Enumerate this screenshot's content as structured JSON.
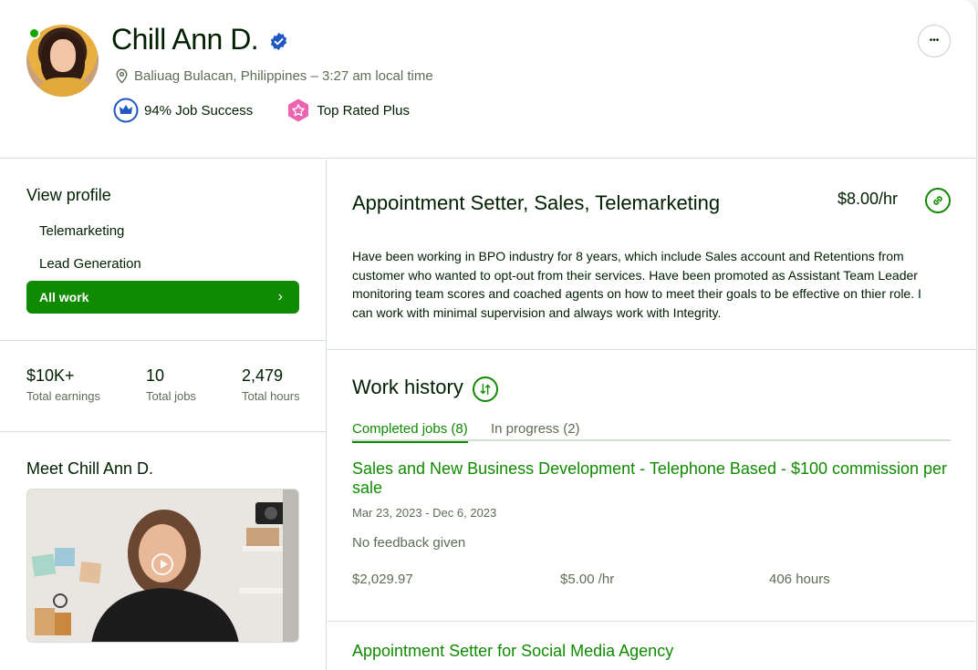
{
  "profile": {
    "name": "Chill Ann D.",
    "location": "Baliuag Bulacan, Philippines – 3:27 am local time",
    "job_success": "94% Job Success",
    "top_rated": "Top Rated Plus",
    "more_label": "•••"
  },
  "sidebar": {
    "view_profile": "View profile",
    "items": [
      {
        "label": "Telemarketing"
      },
      {
        "label": "Lead Generation"
      }
    ],
    "all_work": "All work",
    "all_work_chevron": "›"
  },
  "stats": [
    {
      "value": "$10K+",
      "label": "Total earnings"
    },
    {
      "value": "10",
      "label": "Total jobs"
    },
    {
      "value": "2,479",
      "label": "Total hours"
    }
  ],
  "meet_title": "Meet Chill Ann D.",
  "main": {
    "title": "Appointment Setter, Sales, Telemarketing",
    "rate": "$8.00/hr",
    "description": "Have been working in BPO industry for 8 years, which include Sales account and Retentions from customer who wanted to opt-out from their services. Have been promoted as Assistant Team Leader monitoring team scores and coached agents on how to meet their goals to be effective on thier role. I can work with minimal supervision and always work with Integrity."
  },
  "work_history": {
    "title": "Work history",
    "tabs": [
      {
        "label": "Completed jobs (8)",
        "active": true
      },
      {
        "label": "In progress (2)",
        "active": false
      }
    ],
    "jobs": [
      {
        "title": "Sales and New Business Development - Telephone Based - $100 commission per sale",
        "dates": "Mar 23, 2023 - Dec 6, 2023",
        "feedback": "No feedback given",
        "earned": "$2,029.97",
        "rate": "$5.00 /hr",
        "hours": "406 hours"
      },
      {
        "title": "Appointment Setter for Social Media Agency"
      }
    ]
  },
  "colors": {
    "brand_green": "#108a00",
    "text_dark": "#001e00",
    "text_muted": "#5e6d55",
    "divider": "#d5e0d5",
    "verified_blue": "#1f57c3",
    "top_rated_pink": "#ed63b0"
  }
}
